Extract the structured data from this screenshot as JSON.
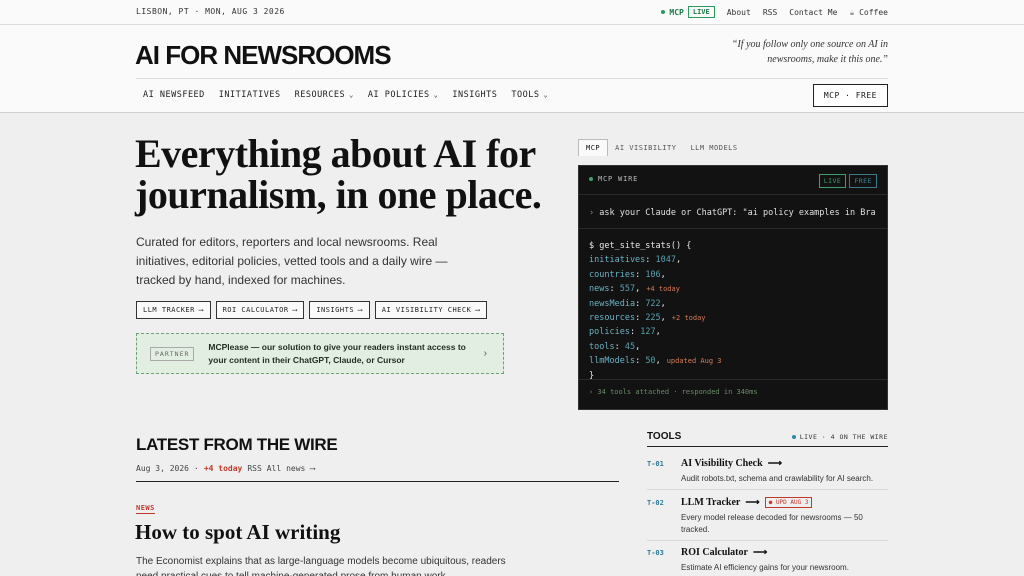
{
  "topbar": {
    "location_date": "LISBON, PT · MON, AUG 3 2026",
    "mcp_label": "MCP",
    "live_label": "LIVE",
    "about": "About",
    "rss": "RSS",
    "contact": "Contact Me",
    "coffee": "Coffee"
  },
  "masthead": {
    "logo": "AI FOR NEWSROOMS",
    "tagline": "“If you follow only one source on AI in newsrooms, make it this one.”",
    "nav": [
      "AI NEWSFEED",
      "INITIATIVES",
      "RESOURCES",
      "AI POLICIES",
      "INSIGHTS",
      "TOOLS"
    ],
    "mcp_free": "MCP · FREE"
  },
  "hero": {
    "title": "Everything about AI for journalism, in one place.",
    "lede": "Curated for editors, reporters and local newsrooms. Real initiatives, editorial policies, vetted tools and a daily wire — tracked by hand, indexed for machines.",
    "links": [
      "LLM TRACKER",
      "ROI CALCULATOR",
      "INSIGHTS",
      "AI VISIBILITY CHECK"
    ],
    "link_arrow": "⟶",
    "partner_badge": "PARTNER",
    "partner_text": "MCPlease — our solution to give your readers instant access to your content in their ChatGPT, Claude, or Cursor"
  },
  "terminal": {
    "tabs": [
      "MCP",
      "AI VISIBILITY",
      "LLM MODELS"
    ],
    "header": "MCP WIRE",
    "badge_live": "LIVE",
    "badge_free": "FREE",
    "prompt": "ask your Claude or ChatGPT: \"ai policy examples in Bra",
    "call": "get_site_stats() {",
    "stats": [
      {
        "key": "initiatives",
        "value": "1047",
        "note": ""
      },
      {
        "key": "countries",
        "value": "106",
        "note": ""
      },
      {
        "key": "news",
        "value": "557",
        "note": "+4 today"
      },
      {
        "key": "newsMedia",
        "value": "722",
        "note": ""
      },
      {
        "key": "resources",
        "value": "225",
        "note": "+2 today"
      },
      {
        "key": "policies",
        "value": "127",
        "note": ""
      },
      {
        "key": "tools",
        "value": "45",
        "note": ""
      },
      {
        "key": "llmModels",
        "value": "50",
        "note": "updated Aug 3"
      }
    ],
    "close": "}",
    "footer": "› 34 tools attached · responded in 340ms"
  },
  "wire": {
    "title": "LATEST FROM THE WIRE",
    "date": "Aug 3, 2026",
    "today": "+4 today",
    "rss": "RSS",
    "all_news": "All news ⟶",
    "story_tag": "NEWS",
    "story_title": "How to spot AI writing",
    "story_dek": "The Economist explains that as large-language models become ubiquitous, readers need practical cues to tell machine-generated prose from human work."
  },
  "tools": {
    "title": "TOOLS",
    "live": "LIVE · 4 ON THE WIRE",
    "items": [
      {
        "num": "T-01",
        "name": "AI Visibility Check",
        "badge": "",
        "desc": "Audit robots.txt, schema and crawlability for AI search."
      },
      {
        "num": "T-02",
        "name": "LLM Tracker",
        "badge": "UPD AUG 3",
        "desc": "Every model release decoded for newsrooms — 50 tracked."
      },
      {
        "num": "T-03",
        "name": "ROI Calculator",
        "badge": "",
        "desc": "Estimate AI efficiency gains for your newsroom."
      }
    ]
  }
}
